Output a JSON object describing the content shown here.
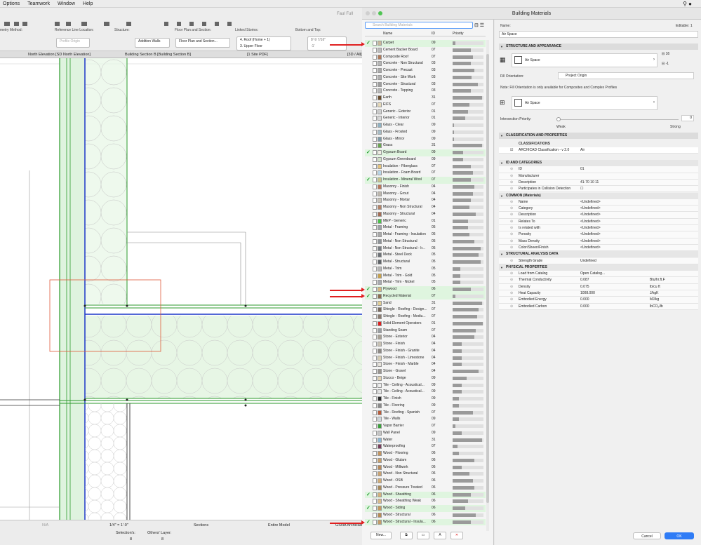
{
  "menubar": {
    "items": [
      "Options",
      "Teamwork",
      "Window",
      "Help"
    ]
  },
  "toolbar": {
    "title": "Faul Full",
    "labels": {
      "geometry": "metry Method:",
      "refline": "Reference Line Location:",
      "structure": "Structure:",
      "floorplan": "Floor Plan and Section:",
      "linked": "Linked Stories:",
      "bottomtop": "Bottom and Top:"
    },
    "profile": "Profile Origin",
    "addition": "Addition Walls",
    "floorplan_value": "Floor Plan and Section...",
    "story_top": "4. Roof (Home + 1)",
    "story_bottom": "3. Upper Floor",
    "dim_top": "8'-9 7/16\"",
    "dim_bottom": "-1'"
  },
  "tabs": [
    "North Elevation [SD North Elevation]",
    "Building Section B [Building Section B]",
    "[1 Site PDF]",
    "[3D / All]"
  ],
  "status": {
    "na": "N/A",
    "scale": "1/4\"  =  1'-0\"",
    "sections": "Sections",
    "model": "Entire Model",
    "gsna": "GSNA Archicad",
    "selections_label": "Selection's:",
    "selections_val": "8",
    "others_label": "Others' Layer:",
    "others_val": "8"
  },
  "bm": {
    "title": "Building Materials",
    "search_placeholder": "Search Building Materials",
    "col_name": "Name",
    "col_id": "ID",
    "col_priority": "Priority",
    "rows": [
      {
        "name": "Carpet",
        "id": "09",
        "p": 0.1,
        "c": "#c9b89a",
        "s": true
      },
      {
        "name": "Cement Backer Board",
        "id": "07",
        "p": 0.6,
        "c": "#bcbcbc",
        "s": false
      },
      {
        "name": "Composite Roof",
        "id": "07",
        "p": 0.65,
        "c": "#b07a5a",
        "s": false
      },
      {
        "name": "Concrete - Non Structural",
        "id": "03",
        "p": 0.6,
        "c": "#b6b6b6",
        "s": false
      },
      {
        "name": "Concrete - Precast",
        "id": "03",
        "p": 0.7,
        "c": "#aaaaaa",
        "s": false
      },
      {
        "name": "Concrete - Site Work",
        "id": "03",
        "p": 0.62,
        "c": "#b0b0b0",
        "s": false
      },
      {
        "name": "Concrete - Structural",
        "id": "03",
        "p": 0.82,
        "c": "#9e9e9e",
        "s": false
      },
      {
        "name": "Concrete - Topping",
        "id": "03",
        "p": 0.6,
        "c": "#b8b8b8",
        "s": false
      },
      {
        "name": "Earth",
        "id": "31",
        "p": 0.95,
        "c": "#6b4e2e",
        "s": false
      },
      {
        "name": "EIFS",
        "id": "07",
        "p": 0.55,
        "c": "#e6d9b8",
        "s": false
      },
      {
        "name": "Generic - Exterior",
        "id": "01",
        "p": 0.5,
        "c": "#cfcfcf",
        "s": false
      },
      {
        "name": "Generic - Interior",
        "id": "01",
        "p": 0.42,
        "c": "#d9d9d9",
        "s": false
      },
      {
        "name": "Glass - Clear",
        "id": "09",
        "p": 0.05,
        "c": "#8fb3c4",
        "s": false
      },
      {
        "name": "Glass - Frosted",
        "id": "09",
        "p": 0.05,
        "c": "#a6bcc6",
        "s": false
      },
      {
        "name": "Glass - Mirror",
        "id": "09",
        "p": 0.05,
        "c": "#7f9ba8",
        "s": false
      },
      {
        "name": "Grass",
        "id": "31",
        "p": 0.95,
        "c": "#6aa84f",
        "s": false
      },
      {
        "name": "Gypsum Board",
        "id": "09",
        "p": 0.35,
        "c": "#f0eee4",
        "s": true
      },
      {
        "name": "Gypsum Greenboard",
        "id": "09",
        "p": 0.35,
        "c": "#cfe3c7",
        "s": false
      },
      {
        "name": "Insulation - Fiberglass",
        "id": "07",
        "p": 0.6,
        "c": "#e7c47a",
        "s": false
      },
      {
        "name": "Insulation - Foam Board",
        "id": "07",
        "p": 0.65,
        "c": "#b9d7ea",
        "s": false
      },
      {
        "name": "Insulation - Mineral Wool",
        "id": "07",
        "p": 0.6,
        "c": "#c9c38b",
        "s": true
      },
      {
        "name": "Masonry - Finish",
        "id": "04",
        "p": 0.7,
        "c": "#b9785a",
        "s": false
      },
      {
        "name": "Masonry - Grout",
        "id": "04",
        "p": 0.65,
        "c": "#bdb7ad",
        "s": false
      },
      {
        "name": "Masonry - Mortar",
        "id": "04",
        "p": 0.6,
        "c": "#c8c2b6",
        "s": false
      },
      {
        "name": "Masonry - Non Structural",
        "id": "04",
        "p": 0.55,
        "c": "#b58367",
        "s": false
      },
      {
        "name": "Masonry - Structural",
        "id": "04",
        "p": 0.75,
        "c": "#a56d55",
        "s": false
      },
      {
        "name": "MEP - Generic",
        "id": "01",
        "p": 0.5,
        "c": "#48c448",
        "s": false
      },
      {
        "name": "Metal - Framing",
        "id": "05",
        "p": 0.5,
        "c": "#9ea3a8",
        "s": false
      },
      {
        "name": "Metal - Framing - Insulation",
        "id": "05",
        "p": 0.55,
        "c": "#a9a9a9",
        "s": false
      },
      {
        "name": "Metal - Non Structural",
        "id": "05",
        "p": 0.7,
        "c": "#8e9398",
        "s": false
      },
      {
        "name": "Metal - Non Structural - Ir...",
        "id": "05",
        "p": 0.9,
        "c": "#7a7f84",
        "s": false
      },
      {
        "name": "Metal - Steel Deck",
        "id": "05",
        "p": 0.85,
        "c": "#6d7277",
        "s": false
      },
      {
        "name": "Metal - Structural",
        "id": "05",
        "p": 0.92,
        "c": "#5f6469",
        "s": false
      },
      {
        "name": "Metal - Trim",
        "id": "05",
        "p": 0.25,
        "c": "#b6b6b6",
        "s": false
      },
      {
        "name": "Metal - Trim - Gold",
        "id": "05",
        "p": 0.25,
        "c": "#c9a24a",
        "s": false
      },
      {
        "name": "Metal - Trim - Nickel",
        "id": "05",
        "p": 0.25,
        "c": "#a8aab0",
        "s": false
      },
      {
        "name": "Plywood",
        "id": "06",
        "p": 0.6,
        "c": "#d9b77e",
        "s": true
      },
      {
        "name": "Recycled Material",
        "id": "07",
        "p": 0.1,
        "c": "#8b6f4e",
        "s": true
      },
      {
        "name": "Sand",
        "id": "31",
        "p": 0.95,
        "c": "#e3cf95",
        "s": false
      },
      {
        "name": "Shingle - Roofing - Design...",
        "id": "07",
        "p": 0.85,
        "c": "#7a6a5e",
        "s": false
      },
      {
        "name": "Shingle - Roofing - Mediu...",
        "id": "07",
        "p": 0.8,
        "c": "#8b7b6f",
        "s": false
      },
      {
        "name": "Solid Element Operators",
        "id": "01",
        "p": 0.98,
        "c": "#e02020",
        "s": false
      },
      {
        "name": "Standing Seam",
        "id": "07",
        "p": 0.75,
        "c": "#9a9ea3",
        "s": false
      },
      {
        "name": "Stone - Exterior",
        "id": "04",
        "p": 0.7,
        "c": "#a8a195",
        "s": false
      },
      {
        "name": "Stone - Finish",
        "id": "04",
        "p": 0.3,
        "c": "#c9c2b4",
        "s": false
      },
      {
        "name": "Stone - Finish - Granite",
        "id": "04",
        "p": 0.3,
        "c": "#8e8a86",
        "s": false
      },
      {
        "name": "Stone - Finish - Limestone",
        "id": "04",
        "p": 0.3,
        "c": "#d8cfb5",
        "s": false
      },
      {
        "name": "Stone - Finish - Marble",
        "id": "04",
        "p": 0.3,
        "c": "#e8e4dc",
        "s": false
      },
      {
        "name": "Stone - Gravel",
        "id": "04",
        "p": 0.85,
        "c": "#9a9590",
        "s": false
      },
      {
        "name": "Stucco - Beige",
        "id": "09",
        "p": 0.45,
        "c": "#e3d3b1",
        "s": false
      },
      {
        "name": "Tile - Ceiling - Acoustical...",
        "id": "09",
        "p": 0.3,
        "c": "#eeeeee",
        "s": false
      },
      {
        "name": "Tile - Ceiling - Acoustical...",
        "id": "09",
        "p": 0.3,
        "c": "#e6e6e6",
        "s": false
      },
      {
        "name": "Tile - Finish",
        "id": "09",
        "p": 0.2,
        "c": "#2b2b2b",
        "s": false
      },
      {
        "name": "Tile - Flooring",
        "id": "09",
        "p": 0.2,
        "c": "#8a8a8a",
        "s": false
      },
      {
        "name": "Tile - Roofing - Spanish",
        "id": "07",
        "p": 0.65,
        "c": "#b95c3a",
        "s": false
      },
      {
        "name": "Tile - Walls",
        "id": "09",
        "p": 0.2,
        "c": "#cfd8dc",
        "s": false
      },
      {
        "name": "Vapor Barrier",
        "id": "07",
        "p": 0.1,
        "c": "#3aa23a",
        "s": false
      },
      {
        "name": "Wall Panel",
        "id": "09",
        "p": 0.3,
        "c": "#c6c6c6",
        "s": false
      },
      {
        "name": "Water",
        "id": "31",
        "p": 0.95,
        "c": "#8bb8d6",
        "s": false
      },
      {
        "name": "Waterproofing",
        "id": "07",
        "p": 0.15,
        "c": "#7a3e5e",
        "s": false
      },
      {
        "name": "Wood - Flooring",
        "id": "06",
        "p": 0.2,
        "c": "#c4955f",
        "s": false
      },
      {
        "name": "Wood - Glulam",
        "id": "06",
        "p": 0.7,
        "c": "#c8a06a",
        "s": false
      },
      {
        "name": "Wood - Millwork",
        "id": "06",
        "p": 0.3,
        "c": "#b98a58",
        "s": false
      },
      {
        "name": "Wood - Non Structural",
        "id": "06",
        "p": 0.55,
        "c": "#caa372",
        "s": false
      },
      {
        "name": "Wood - OSB",
        "id": "06",
        "p": 0.65,
        "c": "#d2ad77",
        "s": false
      },
      {
        "name": "Wood - Pressure Treated",
        "id": "06",
        "p": 0.7,
        "c": "#a88a5a",
        "s": false
      },
      {
        "name": "Wood - Sheathing",
        "id": "06",
        "p": 0.6,
        "c": "#d5b17c",
        "s": true
      },
      {
        "name": "Wood - Sheathing Weak",
        "id": "06",
        "p": 0.5,
        "c": "#d9bb8a",
        "s": false
      },
      {
        "name": "Wood - Siding",
        "id": "06",
        "p": 0.4,
        "c": "#c59a60",
        "s": true
      },
      {
        "name": "Wood - Structural",
        "id": "06",
        "p": 0.75,
        "c": "#b98c55",
        "s": false
      },
      {
        "name": "Wood - Structural - Insula...",
        "id": "06",
        "p": 0.6,
        "c": "#c69d68",
        "s": true
      }
    ],
    "buttons": {
      "new": "New..."
    },
    "name_label": "Name:",
    "editable": "Editable: 1",
    "name_value": "Air Space",
    "structure_section": "STRUCTURE AND APPEARANCE",
    "fill_name": "Air Space",
    "pen1": "16",
    "pen2": "-1",
    "fill_orientation_label": "Fill Orientation:",
    "fill_orientation_value": "Project Origin",
    "note": "Note: Fill Orientation is only available for Composites and Complex Profiles",
    "surface": "Air Space",
    "intersection_label": "Intersection Priority:",
    "intersection_value": "0",
    "weak": "Weak",
    "strong": "Strong",
    "class_section": "CLASSIFICATION AND PROPERTIES",
    "classifications": "CLASSIFICATIONS",
    "class_name": "ARCHICAD Classification - v 2.0",
    "class_value": "Air",
    "props": [
      {
        "t": "sec",
        "k": "ID AND CATEGORIES"
      },
      {
        "k": "ID",
        "v": "01"
      },
      {
        "k": "Manufacturer",
        "v": ""
      },
      {
        "k": "Description",
        "v": "41-70 10 11"
      },
      {
        "k": "Participates in Collision Detection",
        "v": "☐"
      },
      {
        "t": "sec",
        "k": "COMMON (Materials)"
      },
      {
        "k": "Name",
        "v": "<Undefined>"
      },
      {
        "k": "Category",
        "v": "<Undefined>"
      },
      {
        "k": "Description",
        "v": "<Undefined>"
      },
      {
        "k": "Relates To",
        "v": "<Undefined>"
      },
      {
        "k": "Is related with",
        "v": "<Undefined>"
      },
      {
        "k": "Porosity",
        "v": "<Undefined>"
      },
      {
        "k": "Mass Density",
        "v": "<Undefined>"
      },
      {
        "k": "Color/Sheen/Finish",
        "v": "<Undefined>"
      },
      {
        "t": "sec",
        "k": "STRUCTURAL ANALYSIS DATA"
      },
      {
        "k": "Strength Grade",
        "v": "Undefined"
      },
      {
        "t": "sec",
        "k": "PHYSICAL PROPERTIES"
      },
      {
        "k": "Load from Catalog",
        "v": "Open Catalog..."
      },
      {
        "k": "Thermal Conductivity",
        "v": "0.087",
        "u": "Btu/hr.ft.F"
      },
      {
        "k": "Density",
        "v": "0.075",
        "u": "lb/cu ft"
      },
      {
        "k": "Heat Capacity",
        "v": "1008.000",
        "u": "J/kgK"
      },
      {
        "k": "Embodied Energy",
        "v": "0.000",
        "u": "MJ/kg"
      },
      {
        "k": "Embodied Carbon",
        "v": "0.000",
        "u": "lbCO₂/lb"
      }
    ],
    "cancel": "Cancel",
    "ok": "OK"
  }
}
